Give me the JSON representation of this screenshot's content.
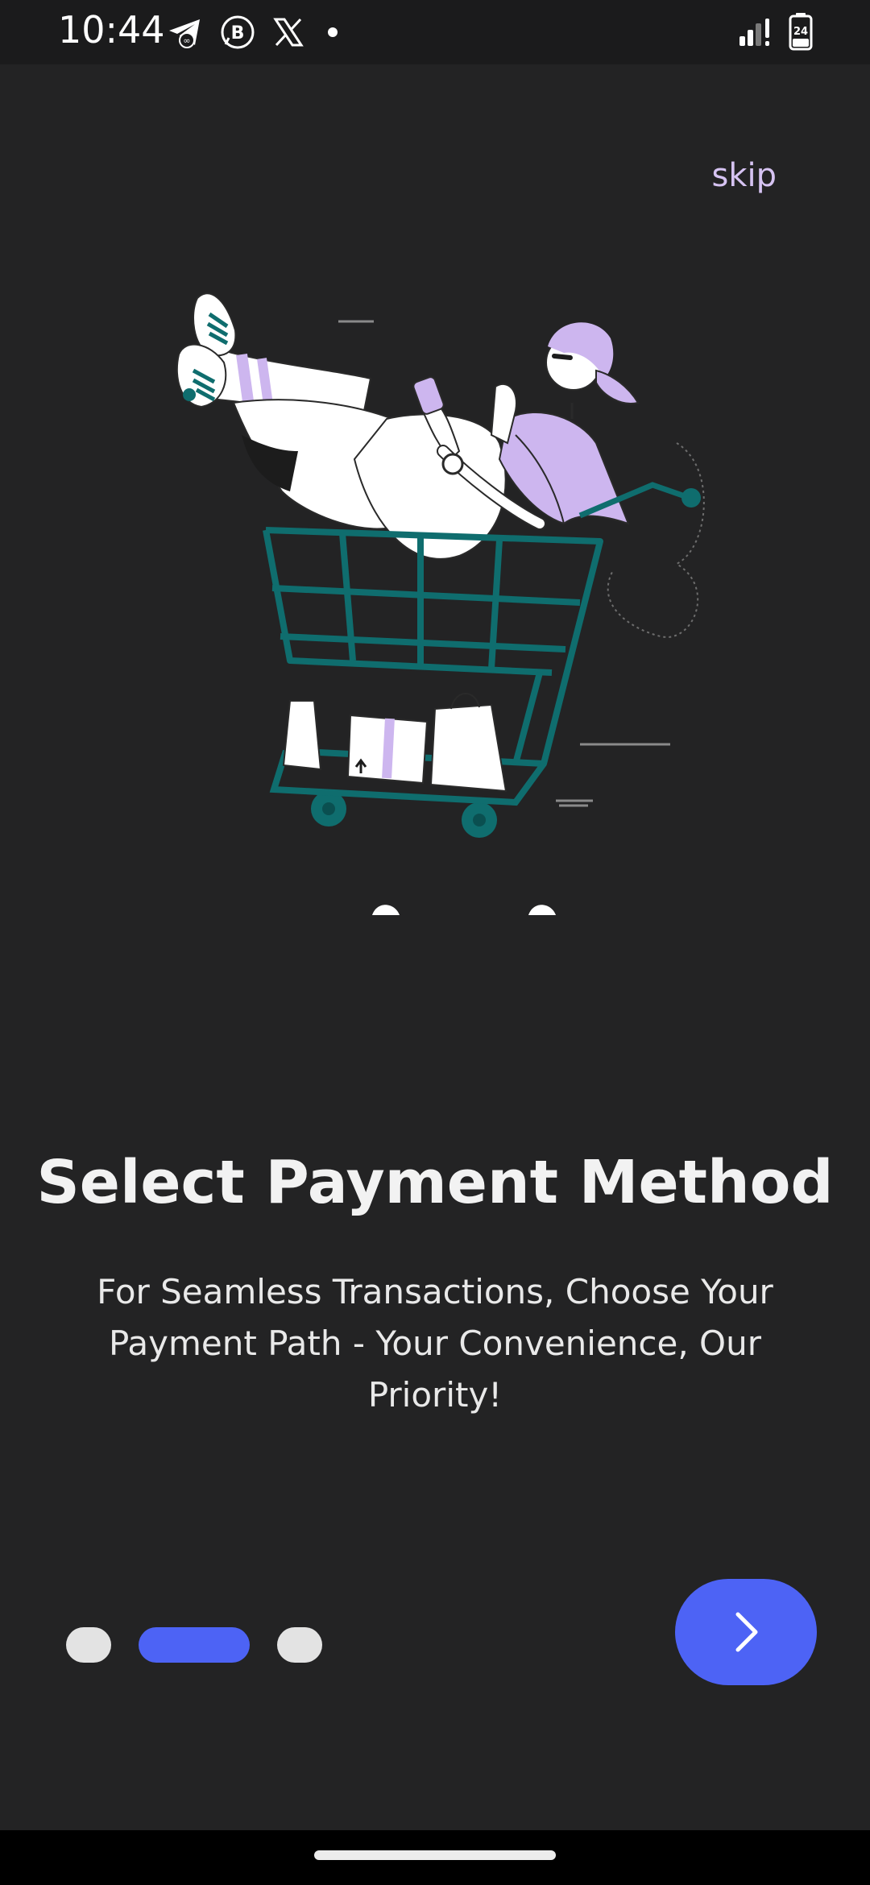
{
  "status_bar": {
    "time": "10:44",
    "left_icons": [
      "telegram-icon",
      "business-chat-icon",
      "x-icon",
      "notification-dot-icon"
    ],
    "right_icons": [
      "signal-icon",
      "battery-icon"
    ],
    "battery_level": "24"
  },
  "onboarding": {
    "skip_label": "skip",
    "illustration": "woman-in-shopping-cart-illustration",
    "title": "Select Payment Method",
    "description": "For Seamless Transactions, Choose Your Payment Path - Your Convenience, Our Priority!",
    "pager": {
      "total": 3,
      "active_index": 1
    },
    "next_icon": "chevron-right-icon"
  },
  "colors": {
    "background": "#232324",
    "accent": "#4d63f5",
    "skip": "#d6c3f2",
    "illustration_teal": "#0f6d6e",
    "illustration_lavender": "#cdb6ef"
  }
}
